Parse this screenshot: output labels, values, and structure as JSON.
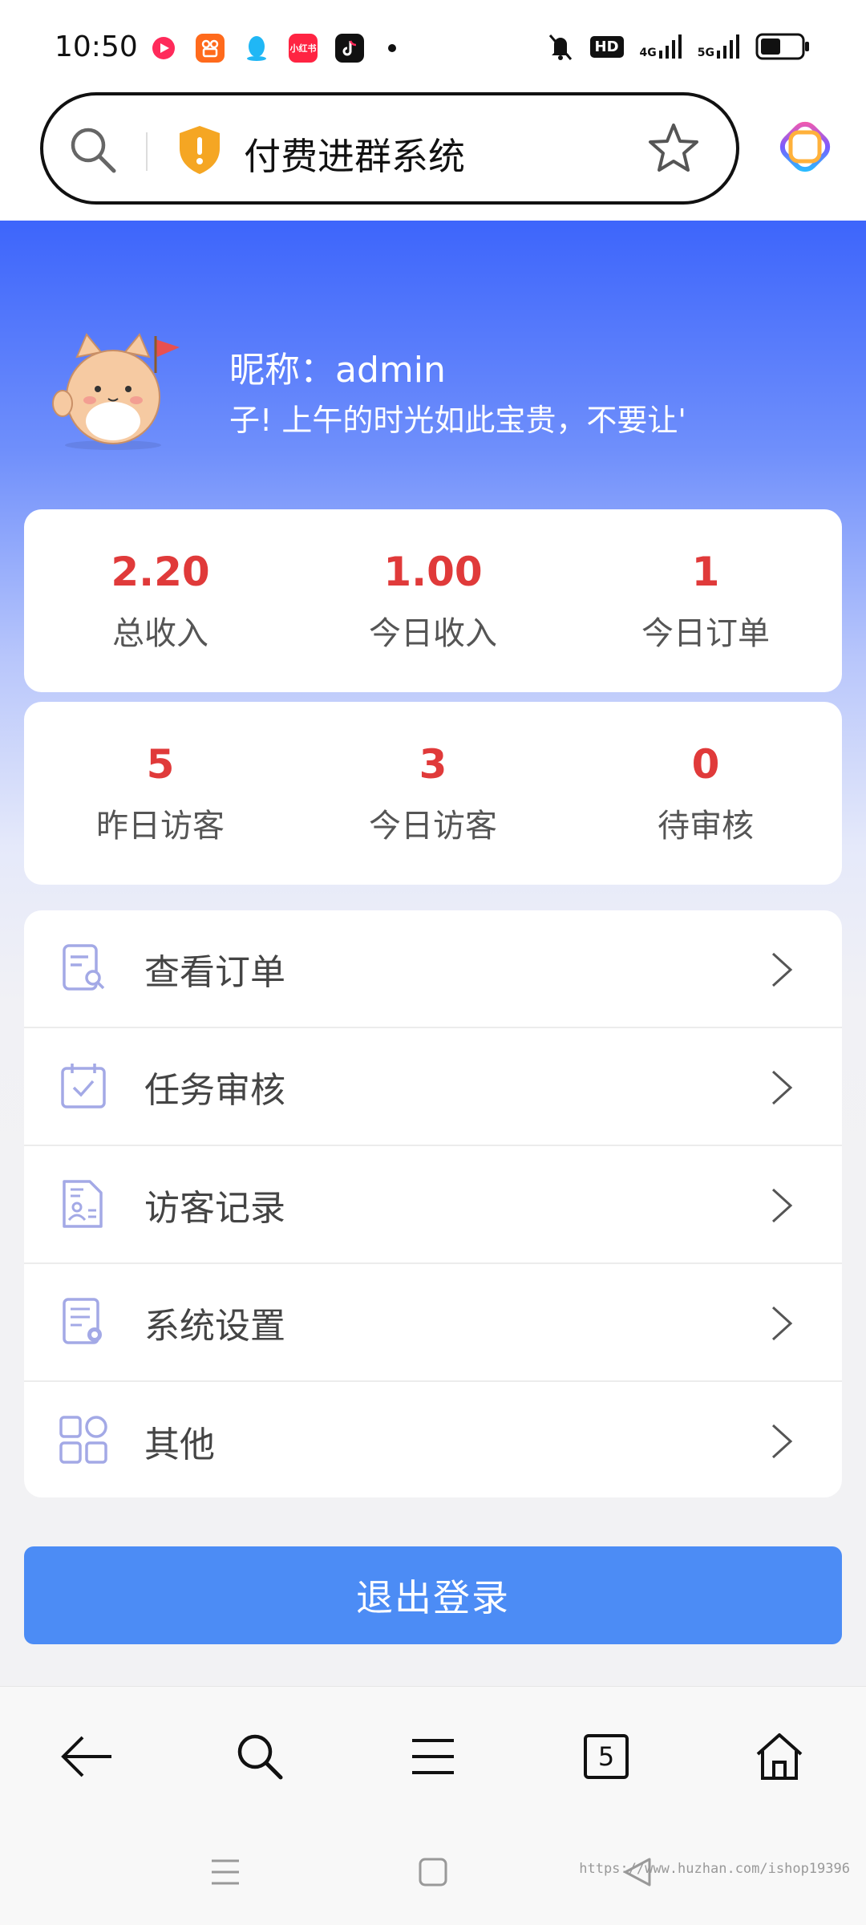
{
  "status_bar": {
    "time": "10:50",
    "notifications": [
      "video-app-icon",
      "kuaishou-icon",
      "qq-icon",
      "xiaohongshu-icon",
      "tiktok-icon"
    ],
    "xhs_label": "小红书",
    "system": [
      "mute-icon",
      "hd-icon",
      "4g-signal-icon",
      "5g-signal-icon",
      "battery-icon"
    ],
    "hd_label": "HD",
    "net_4g": "4G",
    "net_5g": "5G",
    "battery_level": 0.5
  },
  "browser": {
    "title": "付费进群系统"
  },
  "profile": {
    "nickname": "昵称：admin",
    "greeting": "子! 上午的时光如此宝贵，不要让'"
  },
  "stats_row1": [
    {
      "value": "2.20",
      "label": "总收入"
    },
    {
      "value": "1.00",
      "label": "今日收入"
    },
    {
      "value": "1",
      "label": "今日订单"
    }
  ],
  "stats_row2": [
    {
      "value": "5",
      "label": "昨日访客"
    },
    {
      "value": "3",
      "label": "今日访客"
    },
    {
      "value": "0",
      "label": "待审核"
    }
  ],
  "menu": [
    {
      "label": "查看订单",
      "icon": "order-search-icon"
    },
    {
      "label": "任务审核",
      "icon": "calendar-check-icon"
    },
    {
      "label": "访客记录",
      "icon": "visitor-record-icon"
    },
    {
      "label": "系统设置",
      "icon": "settings-doc-icon"
    },
    {
      "label": "其他",
      "icon": "grid-icon"
    }
  ],
  "logout_label": "退出登录",
  "bottom_nav": {
    "tab_count": "5"
  },
  "watermark": "https://www.huzhan.com/ishop19396",
  "colors": {
    "accent_blue": "#3d65fb",
    "stat_red": "#e03a3a",
    "logout_blue": "#4c8cf5",
    "icon_lavender": "#a3a9e6"
  }
}
